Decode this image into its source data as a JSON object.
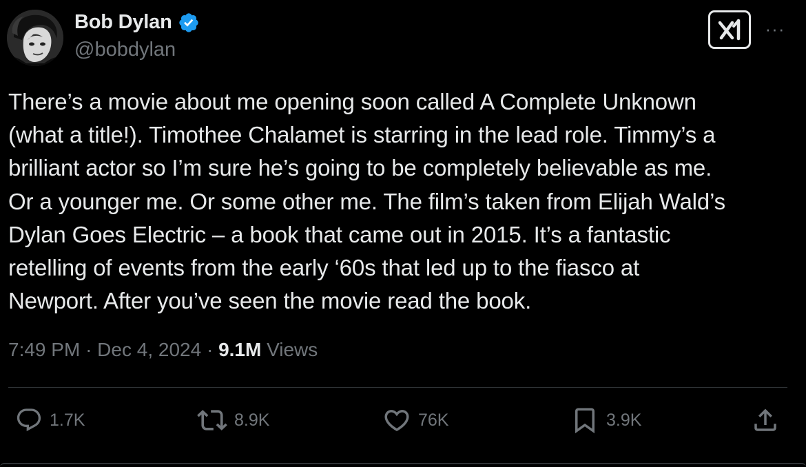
{
  "author": {
    "display_name": "Bob Dylan",
    "handle": "@bobdylan",
    "verified": true,
    "verified_color": "#1d9bf0"
  },
  "tweet": {
    "lines": [
      "There’s a movie about me opening soon called A Complete Unknown",
      "(what a title!). Timothee Chalamet is starring in the lead role. Timmy’s a",
      "brilliant actor so I’m sure he’s going to be completely believable as me.",
      "Or a younger me. Or some other me. The film’s taken from Elijah Wald’s",
      "Dylan Goes Electric – a book that came out in 2015. It’s a fantastic",
      "retelling of events from the early ‘60s that led up to the fiasco at",
      "Newport. After you’ve seen the movie read the book."
    ]
  },
  "meta": {
    "time": "7:49 PM",
    "separator": "·",
    "date": "Dec 4, 2024",
    "views_count": "9.1M",
    "views_label": "Views"
  },
  "actions": {
    "reply_count": "1.7K",
    "repost_count": "8.9K",
    "like_count": "76K",
    "bookmark_count": "3.9K"
  },
  "icons": {
    "reply": "reply-icon",
    "repost": "repost-icon",
    "like": "heart-icon",
    "bookmark": "bookmark-icon",
    "share": "share-icon",
    "grok": "grok-icon",
    "more": "more-icon"
  },
  "colors": {
    "background": "#000000",
    "text_primary": "#e7e9ea",
    "text_secondary": "#71767b",
    "divider": "#2f3336"
  }
}
